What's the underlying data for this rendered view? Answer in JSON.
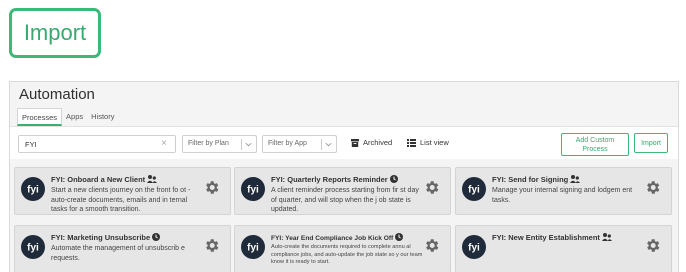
{
  "top": {
    "import_label": "Import"
  },
  "panel": {
    "title": "Automation",
    "tabs": [
      {
        "label": "Processes",
        "active": true
      },
      {
        "label": "Apps",
        "active": false
      },
      {
        "label": "History",
        "active": false
      }
    ]
  },
  "toolbar": {
    "search_value": "FYI",
    "filter_plan_placeholder": "Filter by Plan",
    "filter_app_placeholder": "Filter by App",
    "archived_label": "Archived",
    "list_view_label": "List view",
    "add_custom_process_label": "Add Custom Process",
    "import_label": "Import"
  },
  "cards": [
    {
      "title": "FYI: Onboard a New Client",
      "icon": "user-group-icon",
      "description": "Start a new clients journey on the front fo ot - auto-create documents, emails and in ternal tasks for a smooth transition."
    },
    {
      "title": "FYI: Quarterly Reports Reminder",
      "icon": "clock-icon",
      "description": "A client reminder process starting from fir st day of quarter, and will stop when the j ob state is updated."
    },
    {
      "title": "FYI: Send for Signing",
      "icon": "user-group-icon",
      "description": "Manage your internal signing and lodgem ent tasks."
    },
    {
      "title": "FYI: Marketing Unsubscribe",
      "icon": "clock-icon",
      "description": "Automate the management of unsubscrib e requests."
    },
    {
      "title": "FYI: Year End Compliance Job Kick Off",
      "icon": "clock-icon",
      "description": "Auto-create the documents required to complete annu al compliance jobs, and auto-update the job state so y our team know it is ready to start."
    },
    {
      "title": "FYI: New Entity Establishment",
      "icon": "user-group-icon",
      "description": ""
    }
  ],
  "colors": {
    "accent": "#3cb878",
    "logo": "#1f2b3a",
    "card_bg": "#e6e6e6"
  }
}
